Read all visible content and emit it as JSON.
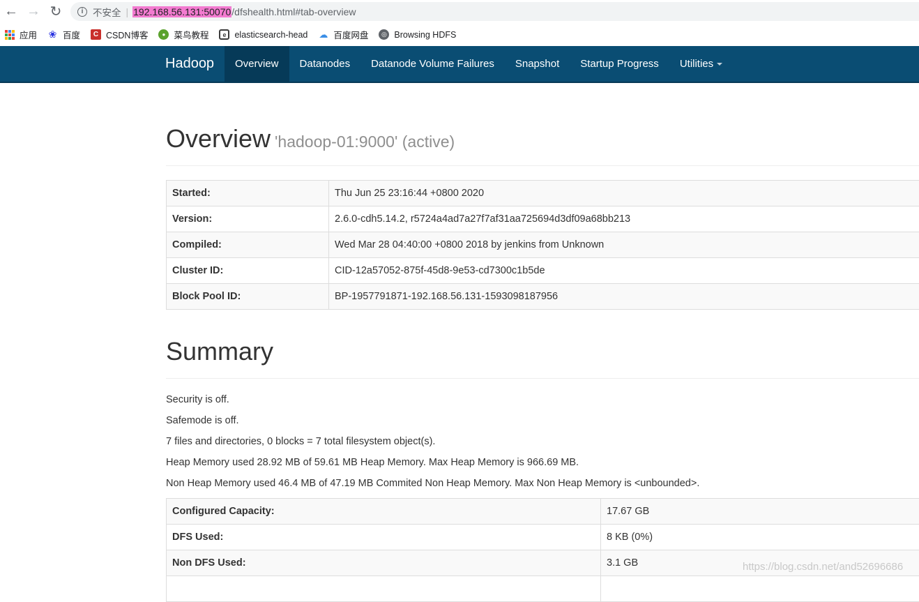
{
  "browser": {
    "security_label": "不安全",
    "url_host": "192.168.56.131:50070",
    "url_path": "/dfshealth.html#tab-overview",
    "bookmarks": [
      {
        "label": "应用",
        "icon": "apps-icon"
      },
      {
        "label": "百度",
        "icon": "baidu-icon"
      },
      {
        "label": "CSDN博客",
        "icon": "csdn-icon"
      },
      {
        "label": "菜鸟教程",
        "icon": "runoob-icon"
      },
      {
        "label": "elasticsearch-head",
        "icon": "elasticsearch-icon"
      },
      {
        "label": "百度网盘",
        "icon": "baidu-pan-icon"
      },
      {
        "label": "Browsing HDFS",
        "icon": "globe-icon"
      }
    ]
  },
  "navbar": {
    "brand": "Hadoop",
    "items": [
      {
        "label": "Overview",
        "active": true
      },
      {
        "label": "Datanodes"
      },
      {
        "label": "Datanode Volume Failures"
      },
      {
        "label": "Snapshot"
      },
      {
        "label": "Startup Progress"
      },
      {
        "label": "Utilities"
      }
    ]
  },
  "overview": {
    "title": "Overview",
    "subtitle": "'hadoop-01:9000' (active)",
    "rows": [
      {
        "key": "Started:",
        "value": "Thu Jun 25 23:16:44 +0800 2020"
      },
      {
        "key": "Version:",
        "value": "2.6.0-cdh5.14.2, r5724a4ad7a27f7af31aa725694d3df09a68bb213"
      },
      {
        "key": "Compiled:",
        "value": "Wed Mar 28 04:40:00 +0800 2018 by jenkins from Unknown"
      },
      {
        "key": "Cluster ID:",
        "value": "CID-12a57052-875f-45d8-9e53-cd7300c1b5de"
      },
      {
        "key": "Block Pool ID:",
        "value": "BP-1957791871-192.168.56.131-1593098187956"
      }
    ]
  },
  "summary": {
    "title": "Summary",
    "lines": [
      "Security is off.",
      "Safemode is off.",
      "7 files and directories, 0 blocks = 7 total filesystem object(s).",
      "Heap Memory used 28.92 MB of 59.61 MB Heap Memory. Max Heap Memory is 966.69 MB.",
      "Non Heap Memory used 46.4 MB of 47.19 MB Commited Non Heap Memory. Max Non Heap Memory is <unbounded>."
    ],
    "rows": [
      {
        "key": "Configured Capacity:",
        "value": "17.67 GB"
      },
      {
        "key": "DFS Used:",
        "value": "8 KB (0%)"
      },
      {
        "key": "Non DFS Used:",
        "value": "3.1 GB"
      },
      {
        "key": "",
        "value": ""
      }
    ]
  },
  "watermark": "https://blog.csdn.net/and52696686",
  "colors": {
    "navbar_bg": "#0a4d73",
    "navbar_active_bg": "#063a58",
    "url_highlight": "#f37bd0"
  }
}
